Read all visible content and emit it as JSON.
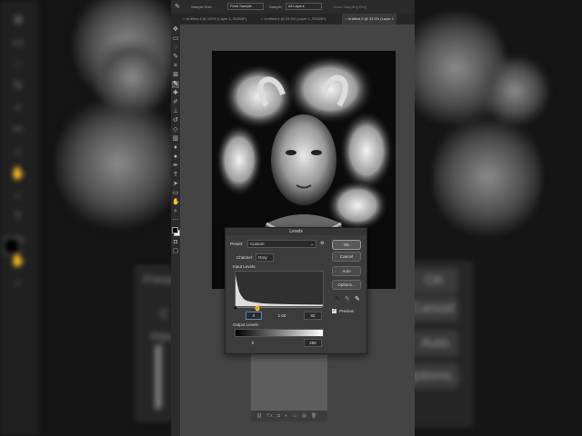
{
  "options_bar": {
    "sample_size_label": "Sample Size:",
    "sample_size_value": "Point Sample",
    "sample_label": "Sample:",
    "sample_value": "All Layers",
    "show_ring": "Show Sampling Ring"
  },
  "tabs": [
    {
      "label": "Untitled-3 @ 100% (Layer 1, RGB/8*)",
      "active": false
    },
    {
      "label": "Untitled-4 @ 33.3% (Layer 1, RGB/8*)",
      "active": false
    },
    {
      "label": "Untitled-5 @ 33.3% (Layer 1",
      "active": true
    }
  ],
  "levels": {
    "title": "Levels",
    "preset_label": "Preset:",
    "preset_value": "Custom",
    "channel_label": "Channel:",
    "channel_value": "Gray",
    "input_levels_label": "Input Levels:",
    "input_black": "0",
    "input_mid": "1.00",
    "input_white": "82",
    "output_levels_label": "Output Levels:",
    "output_black": "0",
    "output_white": "255",
    "ok": "OK",
    "cancel": "Cancel",
    "auto": "Auto",
    "options": "Options...",
    "preview_label": "Preview",
    "preview_checked": true
  },
  "background_ghost": {
    "preset": "Prese",
    "ok": "OK",
    "cancel": "Cancel",
    "auto": "Auto",
    "options": "Options...",
    "input": "Inpu",
    "c_letter": "C"
  },
  "colors": {
    "accent": "#5a5a5a",
    "dialog_bg": "#3c3c3c",
    "frame_bg": "#323232"
  }
}
